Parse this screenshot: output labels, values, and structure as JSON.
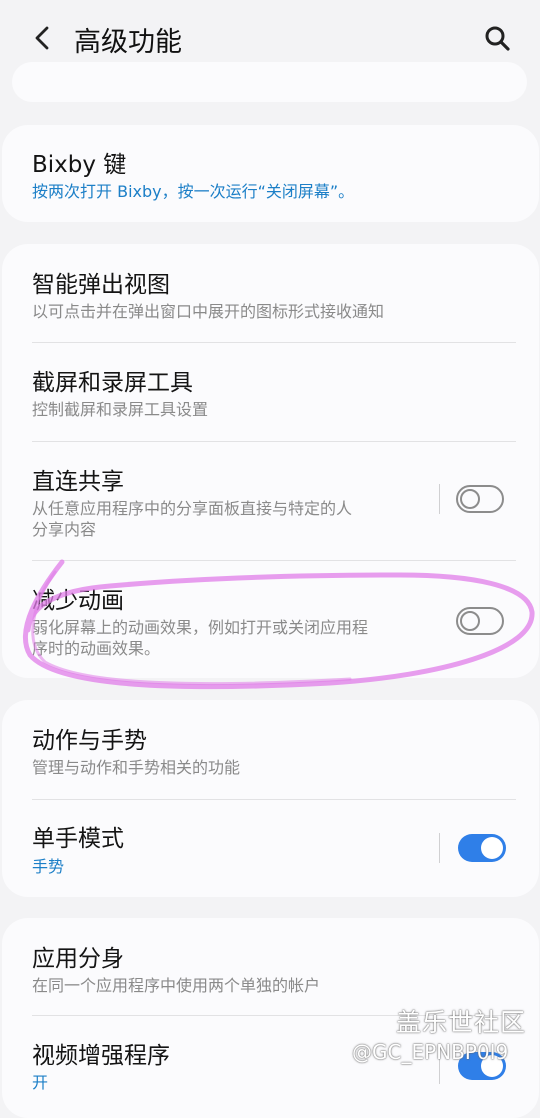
{
  "header": {
    "title": "高级功能",
    "back_icon": "back-arrow-icon",
    "search_icon": "search-icon"
  },
  "cards": {
    "bixby": {
      "title": "Bixby 键",
      "subtitle": "按两次打开 Bixby，按一次运行“关闭屏幕”。"
    },
    "popup": {
      "title": "智能弹出视图",
      "subtitle": "以可点击并在弹出窗口中展开的图标形式接收通知"
    },
    "screenshot": {
      "title": "截屏和录屏工具",
      "subtitle": "控制截屏和录屏工具设置"
    },
    "direct_share": {
      "title": "直连共享",
      "subtitle_1": "从任意应用程序中的分享面板直接与特定的人",
      "subtitle_2": "分享内容",
      "enabled": false
    },
    "reduce_anim": {
      "title": "减少动画",
      "subtitle_1": "弱化屏幕上的动画效果，例如打开或关闭应用程",
      "subtitle_2": "序时的动画效果。",
      "enabled": false
    },
    "motions": {
      "title": "动作与手势",
      "subtitle": "管理与动作和手势相关的功能"
    },
    "one_hand": {
      "title": "单手模式",
      "subtitle": "手势",
      "enabled": true
    },
    "dual_app": {
      "title": "应用分身",
      "subtitle": "在同一个应用程序中使用两个单独的帐户"
    },
    "video_enhance": {
      "title": "视频增强程序",
      "subtitle": "开",
      "enabled": true
    }
  },
  "watermark": {
    "line1": "盖乐世社区",
    "line2": "@GC_EPNBP0I9"
  },
  "colors": {
    "accent_blue": "#1c7fc7",
    "switch_on": "#2f7fe8",
    "annotation": "#e07ee8"
  }
}
